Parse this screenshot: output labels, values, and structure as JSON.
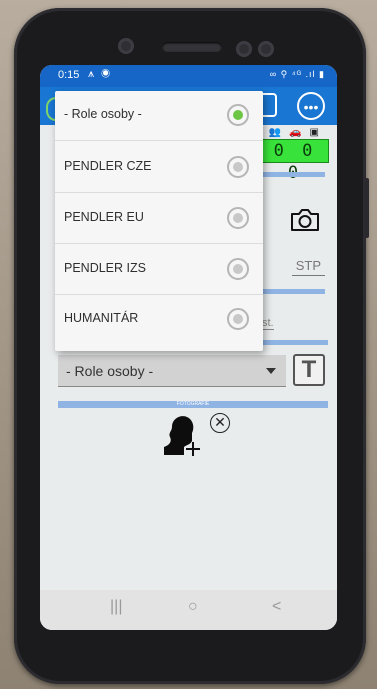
{
  "status_bar": {
    "time": "0:15",
    "left_icons": "⩚ ◉",
    "right_icons": "∞ ⚲ ⁴ᴳ .ıl ▮"
  },
  "app_bar": {
    "menu_icon": "more-horizontal-icon",
    "menu_glyph": "•••"
  },
  "counter": {
    "value": "0 0 0",
    "color": "#39e23a"
  },
  "form": {
    "stp_label": "STP",
    "st_fragment": "st.",
    "role_select_value": "- Role osoby -",
    "t_button_label": "T",
    "photo_strip_label": "FOTOGRAFIE"
  },
  "dropdown": {
    "options": [
      {
        "label": "- Role osoby -",
        "selected": true
      },
      {
        "label": "PENDLER CZE",
        "selected": false
      },
      {
        "label": "PENDLER EU",
        "selected": false
      },
      {
        "label": "PENDLER IZS",
        "selected": false
      },
      {
        "label": "HUMANITÁR",
        "selected": false
      }
    ]
  },
  "navbar": {
    "recent": "|||",
    "home": "○",
    "back": "<"
  },
  "colors": {
    "status_bar": "#1666c7",
    "app_bar": "#1976d2",
    "selected_radio": "#6cc644",
    "accent_strip": "#8fb3e3"
  }
}
